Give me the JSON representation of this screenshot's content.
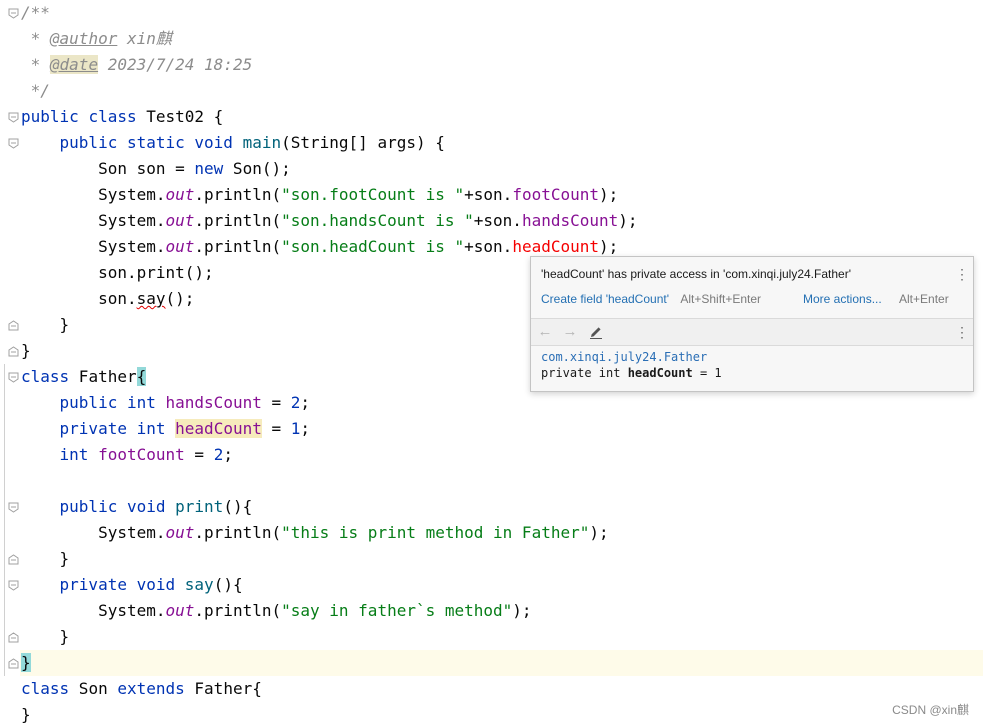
{
  "editor": {
    "lines": [
      [
        {
          "t": "/**",
          "c": "cmt"
        }
      ],
      [
        {
          "t": " * ",
          "c": "cmt"
        },
        {
          "t": "@author",
          "c": "tag"
        },
        {
          "t": " xin麒",
          "c": "cmt"
        }
      ],
      [
        {
          "t": " * ",
          "c": "cmt"
        },
        {
          "t": "@date",
          "c": "tagbox"
        },
        {
          "t": " 2023/7/24 18:25",
          "c": "cmt"
        }
      ],
      [
        {
          "t": " */",
          "c": "cmt"
        }
      ],
      [
        {
          "t": "public",
          "c": "kw"
        },
        {
          "t": " "
        },
        {
          "t": "class",
          "c": "kw"
        },
        {
          "t": " Test02 {"
        }
      ],
      [
        {
          "t": "    "
        },
        {
          "t": "public",
          "c": "kw"
        },
        {
          "t": " "
        },
        {
          "t": "static",
          "c": "kw"
        },
        {
          "t": " "
        },
        {
          "t": "void",
          "c": "kw"
        },
        {
          "t": " "
        },
        {
          "t": "main",
          "c": "mth"
        },
        {
          "t": "(String[] args) {"
        }
      ],
      [
        {
          "t": "        Son son = "
        },
        {
          "t": "new",
          "c": "kw"
        },
        {
          "t": " Son();"
        }
      ],
      [
        {
          "t": "        System."
        },
        {
          "t": "out",
          "c": "stat"
        },
        {
          "t": ".println("
        },
        {
          "t": "\"son.footCount is \"",
          "c": "str"
        },
        {
          "t": "+son."
        },
        {
          "t": "footCount",
          "c": "fld"
        },
        {
          "t": ");"
        }
      ],
      [
        {
          "t": "        System."
        },
        {
          "t": "out",
          "c": "stat"
        },
        {
          "t": ".println("
        },
        {
          "t": "\"son.handsCount is \"",
          "c": "str"
        },
        {
          "t": "+son."
        },
        {
          "t": "handsCount",
          "c": "fld"
        },
        {
          "t": ");"
        }
      ],
      [
        {
          "t": "        System."
        },
        {
          "t": "out",
          "c": "stat"
        },
        {
          "t": ".println("
        },
        {
          "t": "\"son.headCount is \"",
          "c": "str"
        },
        {
          "t": "+son."
        },
        {
          "t": "headCount",
          "c": "err"
        },
        {
          "t": ");"
        }
      ],
      [
        {
          "t": "        son.print();"
        }
      ],
      [
        {
          "t": "        son."
        },
        {
          "t": "say",
          "c": "squiggle"
        },
        {
          "t": "();"
        }
      ],
      [
        {
          "t": "    }"
        }
      ],
      [
        {
          "t": "}"
        }
      ],
      [
        {
          "t": "class",
          "c": "kw"
        },
        {
          "t": " Father"
        },
        {
          "t": "{",
          "c": "brace-hl"
        }
      ],
      [
        {
          "t": "    "
        },
        {
          "t": "public",
          "c": "kw"
        },
        {
          "t": " "
        },
        {
          "t": "int",
          "c": "kw"
        },
        {
          "t": " "
        },
        {
          "t": "handsCount",
          "c": "fld"
        },
        {
          "t": " = "
        },
        {
          "t": "2",
          "c": "kw"
        },
        {
          "t": ";"
        }
      ],
      [
        {
          "t": "    "
        },
        {
          "t": "private",
          "c": "kw"
        },
        {
          "t": " "
        },
        {
          "t": "int",
          "c": "kw"
        },
        {
          "t": " "
        },
        {
          "t": "headCount",
          "c": "fld warn-hl"
        },
        {
          "t": " = "
        },
        {
          "t": "1",
          "c": "kw"
        },
        {
          "t": ";"
        }
      ],
      [
        {
          "t": "    "
        },
        {
          "t": "int",
          "c": "kw"
        },
        {
          "t": " "
        },
        {
          "t": "footCount",
          "c": "fld"
        },
        {
          "t": " = "
        },
        {
          "t": "2",
          "c": "kw"
        },
        {
          "t": ";"
        }
      ],
      [
        {
          "t": ""
        }
      ],
      [
        {
          "t": "    "
        },
        {
          "t": "public",
          "c": "kw"
        },
        {
          "t": " "
        },
        {
          "t": "void",
          "c": "kw"
        },
        {
          "t": " "
        },
        {
          "t": "print",
          "c": "mth"
        },
        {
          "t": "(){"
        }
      ],
      [
        {
          "t": "        System."
        },
        {
          "t": "out",
          "c": "stat"
        },
        {
          "t": ".println("
        },
        {
          "t": "\"this is print method in Father\"",
          "c": "str"
        },
        {
          "t": ");"
        }
      ],
      [
        {
          "t": "    }"
        }
      ],
      [
        {
          "t": "    "
        },
        {
          "t": "private",
          "c": "kw"
        },
        {
          "t": " "
        },
        {
          "t": "void",
          "c": "kw"
        },
        {
          "t": " "
        },
        {
          "t": "say",
          "c": "mth"
        },
        {
          "t": "(){"
        }
      ],
      [
        {
          "t": "        System."
        },
        {
          "t": "out",
          "c": "stat"
        },
        {
          "t": ".println("
        },
        {
          "t": "\"say in father`s method\"",
          "c": "str"
        },
        {
          "t": ");"
        }
      ],
      [
        {
          "t": "    }"
        }
      ],
      [
        {
          "t": "}",
          "c": "brace-hl"
        }
      ],
      [
        {
          "t": "class",
          "c": "kw"
        },
        {
          "t": " Son "
        },
        {
          "t": "extends",
          "c": "kw"
        },
        {
          "t": " Father{"
        }
      ],
      [
        {
          "t": "}"
        }
      ]
    ],
    "highlighted_line": 25,
    "colors": {
      "keyword": "#0033b3",
      "string": "#067d17",
      "field": "#871094",
      "method": "#00627a",
      "error": "#f50000",
      "comment": "#8c8c8c"
    }
  },
  "popup": {
    "message": "'headCount' has private access in 'com.xinqi.july24.Father'",
    "action_label": "Create field 'headCount'",
    "action_shortcut": "Alt+Shift+Enter",
    "more_actions_label": "More actions...",
    "more_actions_shortcut": "Alt+Enter",
    "doc_class": "com.xinqi.july24.Father",
    "doc_declaration_prefix": "private int ",
    "doc_declaration_name": "headCount",
    "doc_declaration_suffix": " = 1",
    "icons": {
      "back": "arrow-left-icon",
      "forward": "arrow-right-icon",
      "edit": "edit-source-icon",
      "menu": "more-vertical-icon"
    }
  },
  "watermark": "CSDN @xin麒"
}
